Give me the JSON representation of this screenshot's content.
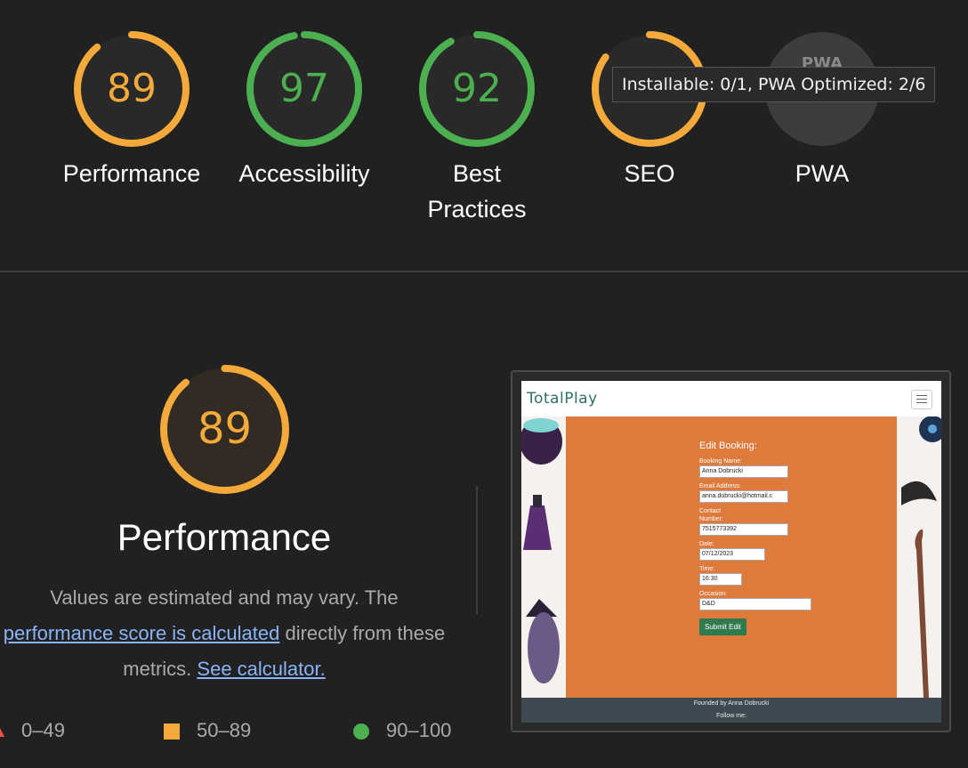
{
  "gauges": [
    {
      "score": "89",
      "label": "Performance",
      "status": "average",
      "fraction": 0.89
    },
    {
      "score": "97",
      "label": "Accessibility",
      "status": "pass",
      "fraction": 0.97
    },
    {
      "score": "92",
      "label": "Best Practices",
      "status": "pass",
      "fraction": 0.92
    },
    {
      "score": "",
      "label": "SEO",
      "status": "average",
      "fraction": 0.85
    },
    {
      "score": "",
      "label": "PWA",
      "status": "na",
      "fraction": 0
    }
  ],
  "pwa_badge_text": "PWA",
  "tooltip": "Installable: 0/1, PWA Optimized: 2/6",
  "performance": {
    "score": "89",
    "fraction": 0.89,
    "title": "Performance",
    "desc_start": "Values are estimated and may vary. The",
    "desc_link": "performance score is calculated",
    "desc_middle": "directly from these metrics.",
    "desc_link2": "See calculator."
  },
  "legend": [
    {
      "range": "0–49",
      "shape": "triangle",
      "color": "#ff4e42"
    },
    {
      "range": "50–89",
      "shape": "square",
      "color": "#f4a93b"
    },
    {
      "range": "90–100",
      "shape": "circle",
      "color": "#4caf50"
    }
  ],
  "colors": {
    "average": "#f4a93b",
    "pass": "#4caf50",
    "fail": "#ff4e42",
    "track": "#3a3a3a"
  },
  "screenshot": {
    "brand": "TotalPlay",
    "form_title": "Edit Booking:",
    "fields": [
      {
        "label": "Booking Name:",
        "value": "Anna Dobrucki"
      },
      {
        "label": "Email Address:",
        "value": "anna.dobrucki@hotmail.c"
      },
      {
        "label": "Contact Number:",
        "value": "7515773392"
      },
      {
        "label": "Date:",
        "value": "07/12/2023"
      },
      {
        "label": "Time:",
        "value": "16:30"
      },
      {
        "label": "Occasion:",
        "value": "D&D"
      }
    ],
    "submit": "Submit Edit",
    "footer_line1": "Founded by Anna Dobrucki",
    "footer_line2": "Follow me:"
  }
}
